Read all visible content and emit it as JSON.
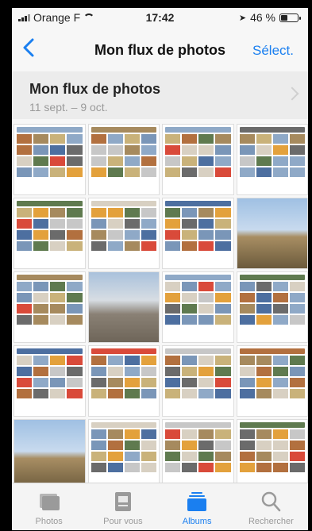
{
  "status_bar": {
    "carrier": "Orange F",
    "time": "17:42",
    "battery": "46 %",
    "battery_level": 0.46
  },
  "nav": {
    "title": "Mon flux de photos",
    "select": "Sélect."
  },
  "stream": {
    "name": "Mon flux de photos",
    "dates": "11 sept. – 9 oct."
  },
  "tabs": [
    {
      "label": "Photos",
      "icon": "photos-icon"
    },
    {
      "label": "Pour vous",
      "icon": "for-you-icon"
    },
    {
      "label": "Albums",
      "icon": "albums-icon"
    },
    {
      "label": "Rechercher",
      "icon": "search-icon"
    }
  ],
  "colors": {
    "accent": "#1a7ff0",
    "inactive": "#9a9a9a"
  }
}
